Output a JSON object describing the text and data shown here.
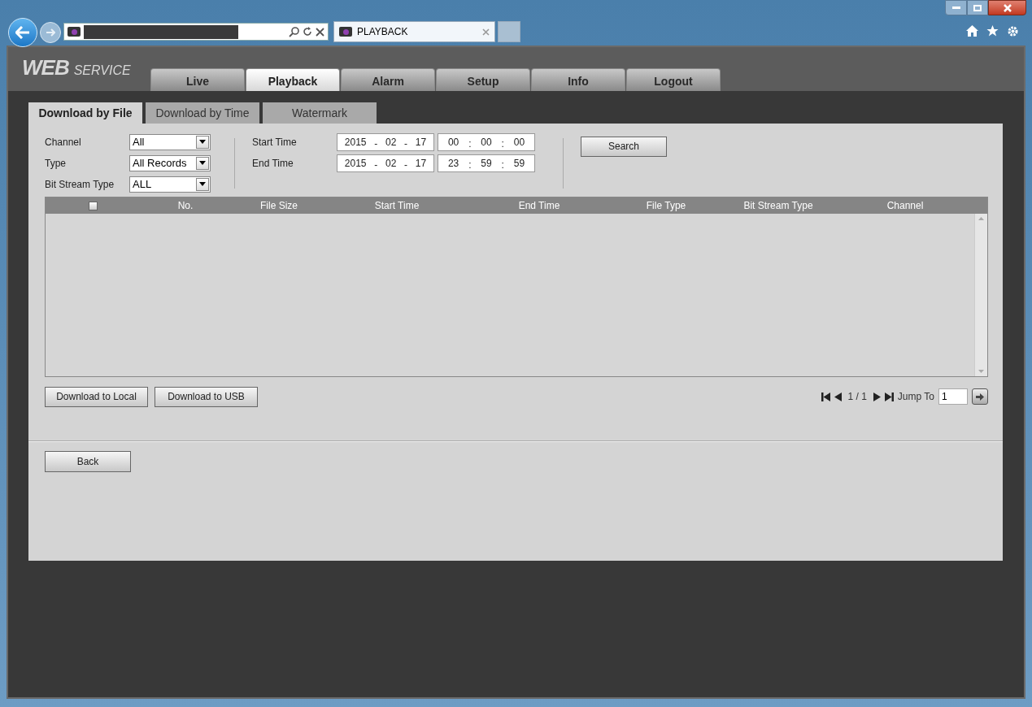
{
  "browser": {
    "tab_title": "PLAYBACK"
  },
  "logo": {
    "primary": "WEB",
    "secondary": "SERVICE"
  },
  "main_tabs": [
    {
      "label": "Live",
      "selected": false
    },
    {
      "label": "Playback",
      "selected": true
    },
    {
      "label": "Alarm",
      "selected": false
    },
    {
      "label": "Setup",
      "selected": false
    },
    {
      "label": "Info",
      "selected": false
    },
    {
      "label": "Logout",
      "selected": false
    }
  ],
  "sub_tabs": [
    {
      "label": "Download by File",
      "selected": true
    },
    {
      "label": "Download by Time",
      "selected": false
    },
    {
      "label": "Watermark",
      "selected": false
    }
  ],
  "filters": [
    {
      "label": "Channel",
      "value": "All"
    },
    {
      "label": "Type",
      "value": "All Records"
    },
    {
      "label": "Bit Stream Type",
      "value": "ALL"
    }
  ],
  "times": [
    {
      "label": "Start Time",
      "date": [
        "2015",
        "-",
        "02",
        "-",
        "17"
      ],
      "time": [
        "00",
        ":",
        "00",
        ":",
        "00"
      ]
    },
    {
      "label": "End Time",
      "date": [
        "2015",
        "-",
        "02",
        "-",
        "17"
      ],
      "time": [
        "23",
        ":",
        "59",
        ":",
        "59"
      ]
    }
  ],
  "search_button": "Search",
  "table": {
    "select_all": {
      "checked": false
    },
    "columns": [
      "No.",
      "File Size",
      "Start Time",
      "End Time",
      "File Type",
      "Bit Stream Type",
      "Channel"
    ]
  },
  "actions": [
    "Download to Local",
    "Download to USB"
  ],
  "pagination": {
    "page": "1 / 1",
    "jump_label": "Jump To",
    "jump_value": "1"
  },
  "back_button": "Back"
}
